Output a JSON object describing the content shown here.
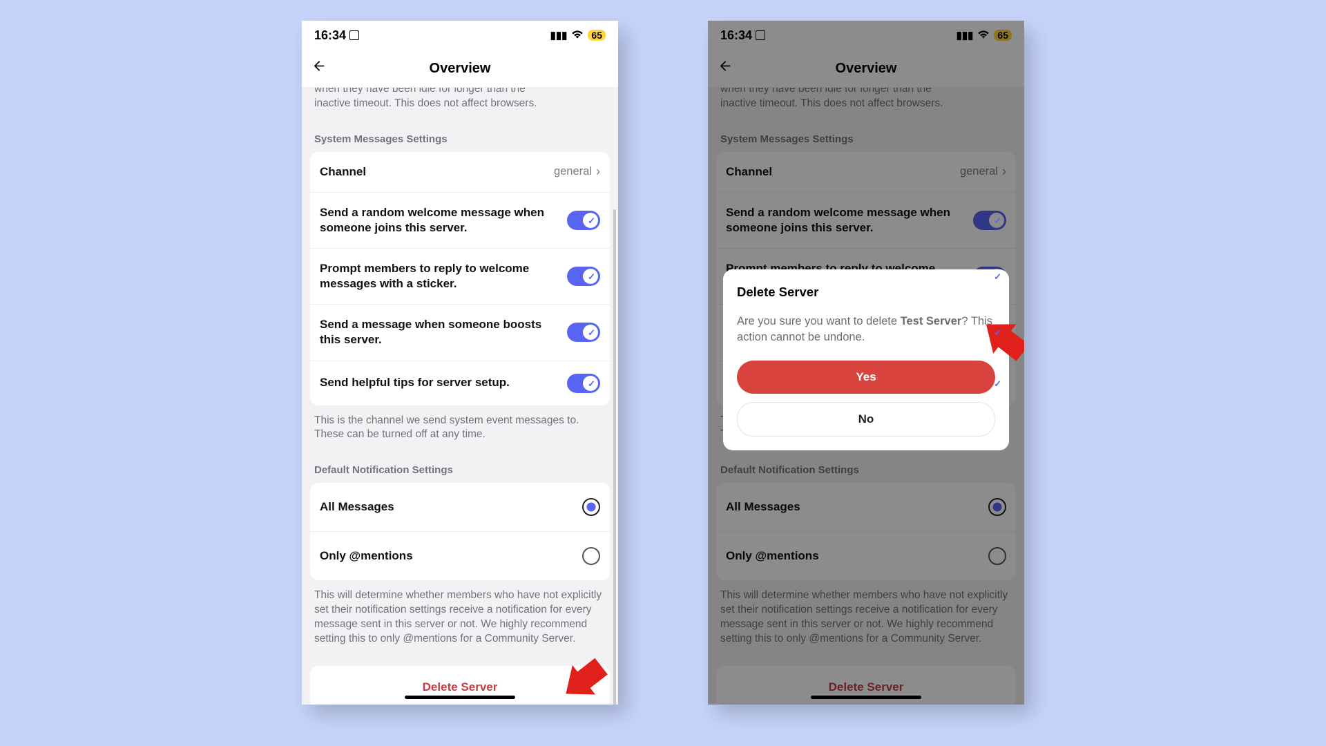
{
  "status": {
    "time": "16:34",
    "battery": "65"
  },
  "nav": {
    "title": "Overview"
  },
  "truncated_line1": "when they have been idle for longer than the",
  "truncated_line2": "inactive timeout. This does not affect browsers.",
  "sections": {
    "system": {
      "header": "System Messages Settings",
      "channel_label": "Channel",
      "channel_value": "general",
      "welcome_label": "Send a random welcome message when someone joins this server.",
      "sticker_label": "Prompt members to reply to welcome messages with a sticker.",
      "boost_label": "Send a message when someone boosts this server.",
      "tips_label": "Send helpful tips for server setup.",
      "footer": "This is the channel we send system event messages to. These can be turned off at any time."
    },
    "notifications": {
      "header": "Default Notification Settings",
      "all_label": "All Messages",
      "mentions_label": "Only @mentions",
      "footer": "This will determine whether members who have not explicitly set their notification settings receive a notification for every message sent in this server or not. We highly recommend setting this to only @mentions for a Community Server."
    }
  },
  "delete_label": "Delete Server",
  "dialog": {
    "title": "Delete Server",
    "prefix": "Are you sure you want to delete ",
    "server": "Test Server",
    "suffix": "? This action cannot be undone.",
    "yes": "Yes",
    "no": "No"
  }
}
